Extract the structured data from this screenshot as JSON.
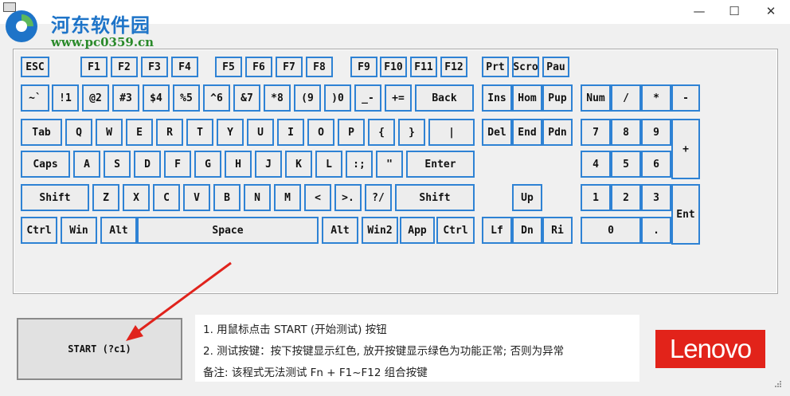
{
  "window": {
    "icons": {
      "app": "keyboard-icon",
      "minimize": "minimize-icon",
      "maximize": "maximize-icon",
      "close": "close-icon"
    },
    "controls": {
      "minimize": "—",
      "maximize": "☐",
      "close": "✕"
    }
  },
  "watermark": {
    "name": "河东软件园",
    "url": "www.pc0359.cn"
  },
  "keyboard": {
    "keys": [
      {
        "id": "esc",
        "label": "ESC"
      },
      {
        "id": "f1",
        "label": "F1"
      },
      {
        "id": "f2",
        "label": "F2"
      },
      {
        "id": "f3",
        "label": "F3"
      },
      {
        "id": "f4",
        "label": "F4"
      },
      {
        "id": "f5",
        "label": "F5"
      },
      {
        "id": "f6",
        "label": "F6"
      },
      {
        "id": "f7",
        "label": "F7"
      },
      {
        "id": "f8",
        "label": "F8"
      },
      {
        "id": "f9",
        "label": "F9"
      },
      {
        "id": "f10",
        "label": "F10"
      },
      {
        "id": "f11",
        "label": "F11"
      },
      {
        "id": "f12",
        "label": "F12"
      },
      {
        "id": "prt",
        "label": "Prt"
      },
      {
        "id": "scro",
        "label": "Scro"
      },
      {
        "id": "pau",
        "label": "Pau"
      },
      {
        "id": "tilde",
        "label": "~`"
      },
      {
        "id": "1",
        "label": "!1"
      },
      {
        "id": "2",
        "label": "@2"
      },
      {
        "id": "3",
        "label": "#3"
      },
      {
        "id": "4",
        "label": "$4"
      },
      {
        "id": "5",
        "label": "%5"
      },
      {
        "id": "6",
        "label": "^6"
      },
      {
        "id": "7",
        "label": "&7"
      },
      {
        "id": "8",
        "label": "*8"
      },
      {
        "id": "9",
        "label": "(9"
      },
      {
        "id": "0",
        "label": ")0"
      },
      {
        "id": "minus",
        "label": "_-"
      },
      {
        "id": "equal",
        "label": "+="
      },
      {
        "id": "back",
        "label": "Back"
      },
      {
        "id": "ins",
        "label": "Ins"
      },
      {
        "id": "hom",
        "label": "Hom"
      },
      {
        "id": "pup",
        "label": "Pup"
      },
      {
        "id": "num",
        "label": "Num"
      },
      {
        "id": "kp-div",
        "label": "/"
      },
      {
        "id": "kp-mul",
        "label": "*"
      },
      {
        "id": "kp-sub",
        "label": "-"
      },
      {
        "id": "tab",
        "label": "Tab"
      },
      {
        "id": "q",
        "label": "Q"
      },
      {
        "id": "w",
        "label": "W"
      },
      {
        "id": "e",
        "label": "E"
      },
      {
        "id": "r",
        "label": "R"
      },
      {
        "id": "t",
        "label": "T"
      },
      {
        "id": "y",
        "label": "Y"
      },
      {
        "id": "u",
        "label": "U"
      },
      {
        "id": "i",
        "label": "I"
      },
      {
        "id": "o",
        "label": "O"
      },
      {
        "id": "p",
        "label": "P"
      },
      {
        "id": "lbrace",
        "label": "{"
      },
      {
        "id": "rbrace",
        "label": "}"
      },
      {
        "id": "pipe",
        "label": "|"
      },
      {
        "id": "del",
        "label": "Del"
      },
      {
        "id": "end",
        "label": "End"
      },
      {
        "id": "pdn",
        "label": "Pdn"
      },
      {
        "id": "kp7",
        "label": "7"
      },
      {
        "id": "kp8",
        "label": "8"
      },
      {
        "id": "kp9",
        "label": "9"
      },
      {
        "id": "kp-add",
        "label": "+"
      },
      {
        "id": "caps",
        "label": "Caps"
      },
      {
        "id": "a",
        "label": "A"
      },
      {
        "id": "s",
        "label": "S"
      },
      {
        "id": "d",
        "label": "D"
      },
      {
        "id": "f",
        "label": "F"
      },
      {
        "id": "g",
        "label": "G"
      },
      {
        "id": "h",
        "label": "H"
      },
      {
        "id": "j",
        "label": "J"
      },
      {
        "id": "k",
        "label": "K"
      },
      {
        "id": "l",
        "label": "L"
      },
      {
        "id": "semi",
        "label": ":;"
      },
      {
        "id": "quote",
        "label": "\""
      },
      {
        "id": "enter",
        "label": "Enter"
      },
      {
        "id": "kp4",
        "label": "4"
      },
      {
        "id": "kp5",
        "label": "5"
      },
      {
        "id": "kp6",
        "label": "6"
      },
      {
        "id": "lshift",
        "label": "Shift"
      },
      {
        "id": "z",
        "label": "Z"
      },
      {
        "id": "x",
        "label": "X"
      },
      {
        "id": "c",
        "label": "C"
      },
      {
        "id": "v",
        "label": "V"
      },
      {
        "id": "b",
        "label": "B"
      },
      {
        "id": "n",
        "label": "N"
      },
      {
        "id": "m",
        "label": "M"
      },
      {
        "id": "comma",
        "label": "<"
      },
      {
        "id": "period",
        "label": ">."
      },
      {
        "id": "slash",
        "label": "?/"
      },
      {
        "id": "rshift",
        "label": "Shift"
      },
      {
        "id": "up",
        "label": "Up"
      },
      {
        "id": "kp1",
        "label": "1"
      },
      {
        "id": "kp2",
        "label": "2"
      },
      {
        "id": "kp3",
        "label": "3"
      },
      {
        "id": "kp-ent",
        "label": "Ent"
      },
      {
        "id": "lctrl",
        "label": "Ctrl"
      },
      {
        "id": "win",
        "label": "Win"
      },
      {
        "id": "lalt",
        "label": "Alt"
      },
      {
        "id": "space",
        "label": "Space"
      },
      {
        "id": "ralt",
        "label": "Alt"
      },
      {
        "id": "win2",
        "label": "Win2"
      },
      {
        "id": "app",
        "label": "App"
      },
      {
        "id": "rctrl",
        "label": "Ctrl"
      },
      {
        "id": "lf",
        "label": "Lf"
      },
      {
        "id": "dn",
        "label": "Dn"
      },
      {
        "id": "ri",
        "label": "Ri"
      },
      {
        "id": "kp0",
        "label": "0"
      },
      {
        "id": "kp-dot",
        "label": "."
      }
    ]
  },
  "start_button": {
    "label": "START (?c1)"
  },
  "instructions": [
    "1.  用鼠标点击 START (开始测试) 按钮",
    "2.  测试按键：按下按键显示红色, 放开按键显示绿色为功能正常; 否则为异常",
    "备注: 该程式无法测试 Fn + F1~F12 组合按键"
  ],
  "logo": {
    "text": "Lenovo"
  },
  "colors": {
    "key_border": "#2e82d4",
    "annotation_arrow": "#e0231c",
    "logo_bg": "#e2231a"
  }
}
